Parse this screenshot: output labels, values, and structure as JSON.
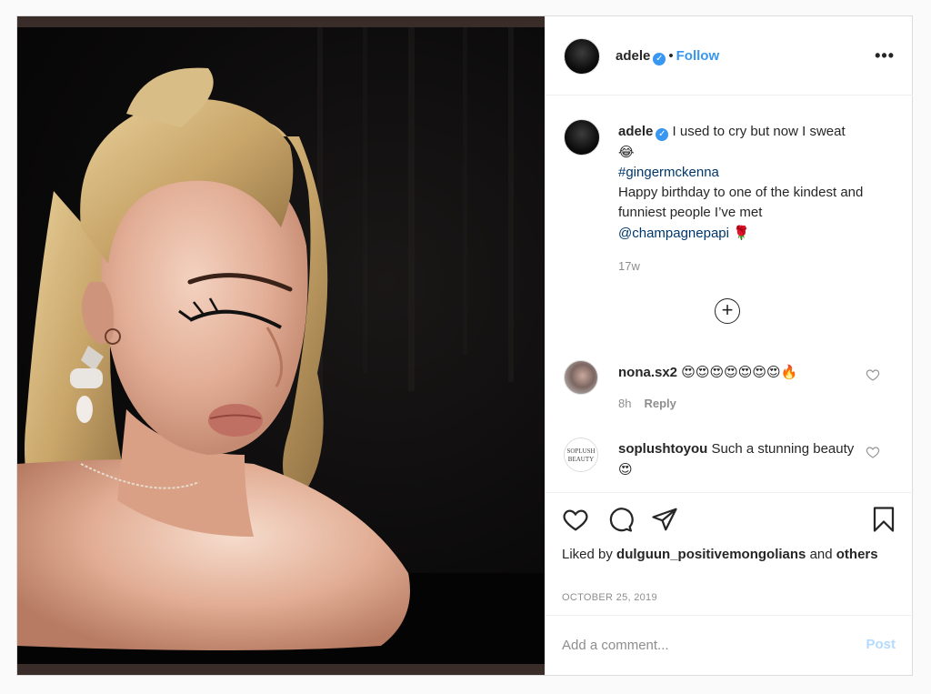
{
  "post": {
    "image_alt": "adele",
    "header": {
      "username": "adele",
      "separator": "•",
      "follow_label": "Follow",
      "more_label": "•••"
    },
    "caption": {
      "username": "adele",
      "line1": "I used to cry but now I sweat",
      "emoji1": "😂",
      "hashtag": "#gingermckenna",
      "text2": "Happy birthday to one of the kindest and funniest people I’ve met",
      "mention": "@champagnepapi",
      "emoji2": "🌹",
      "time": "17w"
    },
    "load_more_label": "+",
    "comments": [
      {
        "username": "nona.sx2",
        "text": "😍😍😍😍😍😍😍🔥",
        "time": "8h",
        "reply_label": "Reply"
      },
      {
        "username": "soplushtoyou",
        "text": "Such a stunning beauty",
        "emoji": "😍",
        "avatar_text": "SOPLUSH BEAUTY"
      }
    ],
    "liked_by": {
      "prefix": "Liked by",
      "user": "dulguun_positivemongolians",
      "and": "and",
      "others": "others"
    },
    "date": "OCTOBER 25, 2019",
    "add_comment": {
      "placeholder": "Add a comment...",
      "post_label": "Post"
    },
    "colors": {
      "link": "#3897f0",
      "hashtag": "#00376b",
      "muted": "#8e8e8e",
      "post_disabled": "#b3dbff"
    },
    "icons": [
      "verified-icon",
      "more-icon",
      "heart-icon",
      "comment-icon",
      "share-icon",
      "bookmark-icon",
      "plus-circle-icon"
    ]
  }
}
